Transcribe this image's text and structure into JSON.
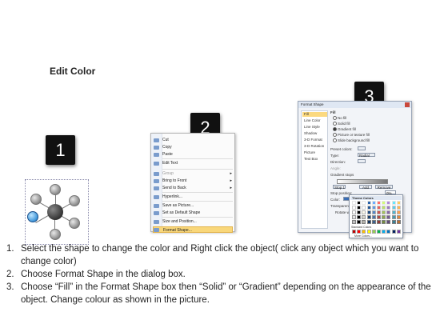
{
  "title": "Edit Color",
  "step_badges": [
    "1",
    "2",
    "3"
  ],
  "context_menu": {
    "items": [
      {
        "label": "Cut",
        "state": "normal"
      },
      {
        "label": "Copy",
        "state": "normal"
      },
      {
        "label": "Paste",
        "state": "normal"
      },
      {
        "label": "Edit Text",
        "state": "normal"
      },
      {
        "label": "Group",
        "state": "dim",
        "submenu": true
      },
      {
        "label": "Bring to Front",
        "state": "normal",
        "submenu": true
      },
      {
        "label": "Send to Back",
        "state": "normal",
        "submenu": true
      },
      {
        "label": "Hyperlink...",
        "state": "normal"
      },
      {
        "label": "Save as Picture...",
        "state": "normal"
      },
      {
        "label": "Set as Default Shape",
        "state": "normal"
      },
      {
        "label": "Size and Position...",
        "state": "normal"
      },
      {
        "label": "Format Shape...",
        "state": "highlight"
      }
    ]
  },
  "dialog": {
    "title": "Format Shape",
    "nav": [
      "Fill",
      "Line Color",
      "Line Style",
      "Shadow",
      "3-D Format",
      "3-D Rotation",
      "Picture",
      "Text Box"
    ],
    "section": "Fill",
    "fill_options": [
      "No fill",
      "Solid fill",
      "Gradient fill",
      "Picture or texture fill",
      "Slide background fill"
    ],
    "preset_colors_label": "Preset colors:",
    "type_label": "Type:",
    "type_value": "Radial",
    "direction_label": "Direction:",
    "angle_label": "Angle:",
    "gradient_stops_label": "Gradient stops",
    "stop_value": "Stop 1",
    "add_label": "Add",
    "remove_label": "Remove",
    "stop_position_label": "Stop position:",
    "stop_position_value": "0%",
    "color_label": "Color:",
    "transparency_label": "Transparency:",
    "rotate_label": "Rotate with shape",
    "palette_header": "Theme Colors",
    "standard_colors_label": "Standard Colors",
    "more_colors_label": "More Colors..."
  },
  "instructions": [
    {
      "num": "1.",
      "text": "Select the shape to change the color and Right click the object( click any object which you want to change color)"
    },
    {
      "num": "2.",
      "text": "Choose Format Shape in the dialog box."
    },
    {
      "num": "3.",
      "text": "Choose “Fill” in the Format Shape box then “Solid” or “Gradient” depending on the appearance of the object. Change colour as shown in the picture."
    }
  ]
}
